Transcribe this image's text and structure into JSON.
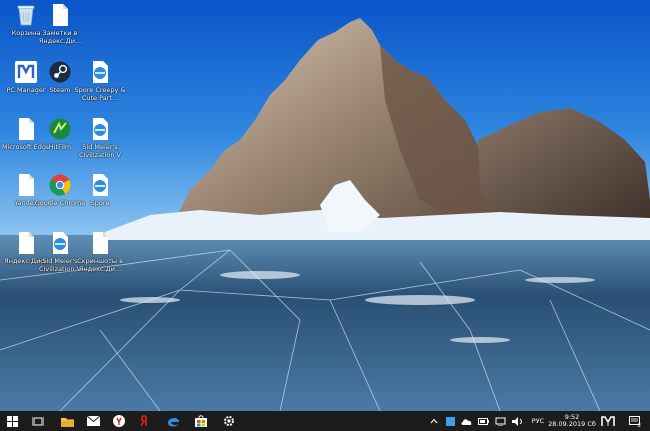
{
  "desktop_icons": [
    {
      "id": "recycle",
      "label": "Корзина"
    },
    {
      "id": "notes",
      "label": "Заметки в Яндекс.Ди..."
    },
    {
      "id": "pcmanager",
      "label": "PC Manager"
    },
    {
      "id": "steam",
      "label": "Steam"
    },
    {
      "id": "spore_creepy",
      "label": "Spore Creepy & Cute Part..."
    },
    {
      "id": "msedge",
      "label": "Microsoft Edge"
    },
    {
      "id": "hitfilm",
      "label": "HitFilm"
    },
    {
      "id": "civ5",
      "label": "Sid Meier's Civilization V"
    },
    {
      "id": "yandex",
      "label": "Yandex"
    },
    {
      "id": "chrome",
      "label": "Google Chrome"
    },
    {
      "id": "spore",
      "label": "Spore"
    },
    {
      "id": "yandex_disk",
      "label": "Яндекс.Диск"
    },
    {
      "id": "game_shortcut",
      "label": "Sid Meier's Civilization V (DX9)"
    },
    {
      "id": "file_shortcut",
      "label": "Скриншоты в Яндекс.Ди..."
    }
  ],
  "taskbar": {
    "apps": [
      "start-icon",
      "task-view-icon",
      "explorer-icon",
      "mail-icon",
      "yandex-browser-icon",
      "yandex-icon",
      "edge-icon",
      "store-icon",
      "settings-icon"
    ],
    "tray": {
      "language": "РУС",
      "time": "9:52",
      "date": "28.09.2019 Сб",
      "notification_count": "2"
    }
  }
}
